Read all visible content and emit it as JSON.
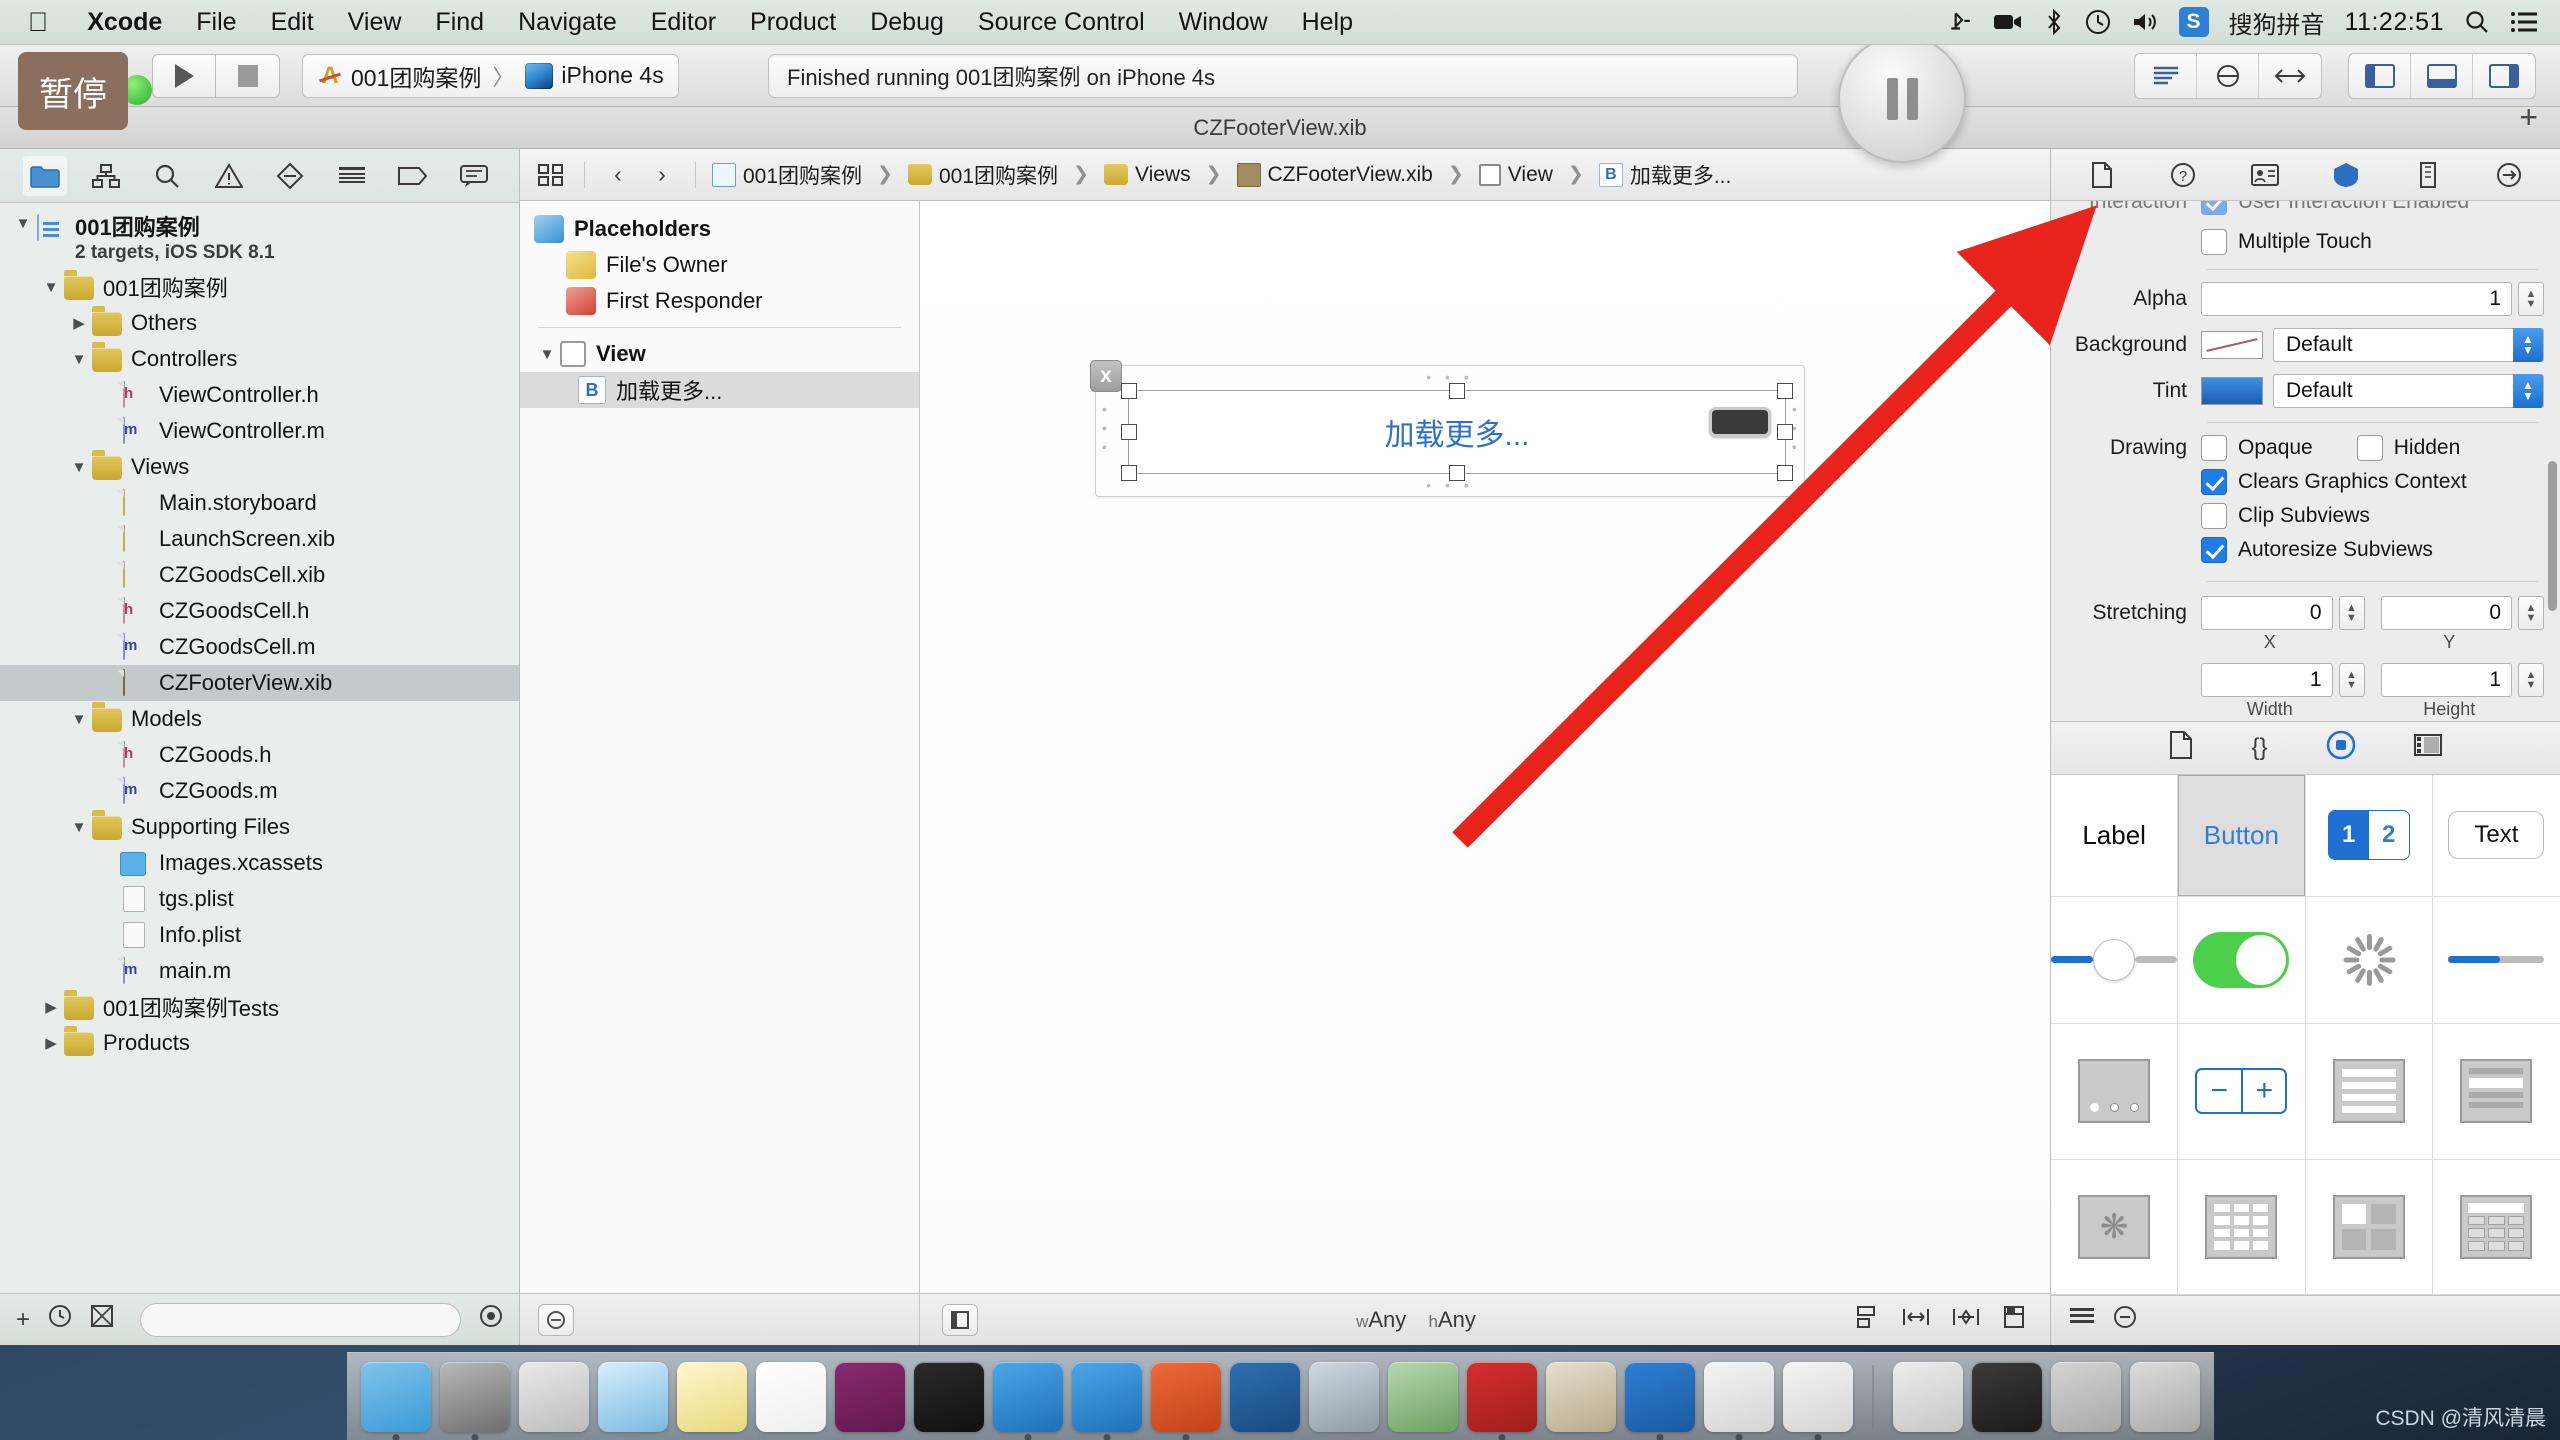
{
  "menubar": {
    "apple": "apple-logo",
    "items": [
      {
        "label": "Xcode",
        "bold": true
      },
      {
        "label": "File",
        "bold": false
      },
      {
        "label": "Edit",
        "bold": false
      },
      {
        "label": "View",
        "bold": false
      },
      {
        "label": "Find",
        "bold": false
      },
      {
        "label": "Navigate",
        "bold": false
      },
      {
        "label": "Editor",
        "bold": false
      },
      {
        "label": "Product",
        "bold": false
      },
      {
        "label": "Debug",
        "bold": false
      },
      {
        "label": "Source Control",
        "bold": false
      },
      {
        "label": "Window",
        "bold": false
      },
      {
        "label": "Help",
        "bold": false
      }
    ],
    "status": {
      "airplay": "⇥",
      "screen_record": "screen-record-icon",
      "bluetooth": "bluetooth-icon",
      "time_machine": "time-machine-icon",
      "volume": "volume-icon",
      "sogou_badge": "S",
      "input_method": "搜狗拼音",
      "clock": "11:22:51",
      "spotlight": "search-icon",
      "notification": "notification-center-icon"
    }
  },
  "toolbar": {
    "tooltip_pause": "暂停",
    "run_label": "run-button",
    "stop_label": "stop-button",
    "scheme_project": "001团购案例",
    "scheme_sep": "〉",
    "scheme_device": "iPhone 4s",
    "status_text": "Finished running 001团购案例 on iPhone 4s",
    "pause_button": "pause-button",
    "editor_modes": [
      "standard-editor",
      "assistant-editor",
      "version-editor"
    ],
    "view_toggles": [
      "navigator-toggle",
      "debug-area-toggle",
      "utilities-toggle"
    ],
    "add_tab": "+"
  },
  "window": {
    "title": "CZFooterView.xib"
  },
  "navigator": {
    "tabs": [
      {
        "name": "project-navigator",
        "glyph": "folder",
        "active": true
      },
      {
        "name": "symbol-navigator",
        "glyph": "hierarchy",
        "active": false
      },
      {
        "name": "find-navigator",
        "glyph": "search",
        "active": false
      },
      {
        "name": "issue-navigator",
        "glyph": "warning",
        "active": false
      },
      {
        "name": "test-navigator",
        "glyph": "diamond",
        "active": false
      },
      {
        "name": "debug-navigator",
        "glyph": "list",
        "active": false
      },
      {
        "name": "breakpoint-navigator",
        "glyph": "tag",
        "active": false
      },
      {
        "name": "log-navigator",
        "glyph": "speech",
        "active": false
      }
    ],
    "tree": [
      {
        "label": "001团购案例",
        "sub": "2 targets, iOS SDK 8.1",
        "indent": 0,
        "twist": "open",
        "icon": "project",
        "bold": true,
        "selected": false
      },
      {
        "label": "001团购案例",
        "indent": 1,
        "twist": "open",
        "icon": "folder",
        "selected": false
      },
      {
        "label": "Others",
        "indent": 2,
        "twist": "closed",
        "icon": "folder",
        "selected": false
      },
      {
        "label": "Controllers",
        "indent": 2,
        "twist": "open",
        "icon": "folder",
        "selected": false
      },
      {
        "label": "ViewController.h",
        "indent": 3,
        "twist": "none",
        "icon": "h",
        "selected": false
      },
      {
        "label": "ViewController.m",
        "indent": 3,
        "twist": "none",
        "icon": "m",
        "selected": false
      },
      {
        "label": "Views",
        "indent": 2,
        "twist": "open",
        "icon": "folder",
        "selected": false
      },
      {
        "label": "Main.storyboard",
        "indent": 3,
        "twist": "none",
        "icon": "xib",
        "selected": false
      },
      {
        "label": "LaunchScreen.xib",
        "indent": 3,
        "twist": "none",
        "icon": "xib",
        "selected": false
      },
      {
        "label": "CZGoodsCell.xib",
        "indent": 3,
        "twist": "none",
        "icon": "xib",
        "selected": false
      },
      {
        "label": "CZGoodsCell.h",
        "indent": 3,
        "twist": "none",
        "icon": "h",
        "selected": false
      },
      {
        "label": "CZGoodsCell.m",
        "indent": 3,
        "twist": "none",
        "icon": "m",
        "selected": false
      },
      {
        "label": "CZFooterView.xib",
        "indent": 3,
        "twist": "none",
        "icon": "dark",
        "selected": true
      },
      {
        "label": "Models",
        "indent": 2,
        "twist": "open",
        "icon": "folder",
        "selected": false
      },
      {
        "label": "CZGoods.h",
        "indent": 3,
        "twist": "none",
        "icon": "h",
        "selected": false
      },
      {
        "label": "CZGoods.m",
        "indent": 3,
        "twist": "none",
        "icon": "m",
        "selected": false
      },
      {
        "label": "Supporting Files",
        "indent": 2,
        "twist": "open",
        "icon": "folder",
        "selected": false
      },
      {
        "label": "Images.xcassets",
        "indent": 3,
        "twist": "none",
        "icon": "asset",
        "selected": false
      },
      {
        "label": "tgs.plist",
        "indent": 3,
        "twist": "none",
        "icon": "plist",
        "selected": false
      },
      {
        "label": "Info.plist",
        "indent": 3,
        "twist": "none",
        "icon": "plist",
        "selected": false
      },
      {
        "label": "main.m",
        "indent": 3,
        "twist": "none",
        "icon": "m",
        "selected": false
      },
      {
        "label": "001团购案例Tests",
        "indent": 1,
        "twist": "closed",
        "icon": "folder",
        "selected": false
      },
      {
        "label": "Products",
        "indent": 1,
        "twist": "closed",
        "icon": "folder",
        "selected": false
      }
    ],
    "bottom": {
      "add": "+",
      "recent": "clock-icon",
      "source_control": "source-control-icon",
      "filter_placeholder": ""
    }
  },
  "jumpbar": {
    "related_items": "related-items-icon",
    "back": "‹",
    "forward": "›",
    "crumbs": [
      {
        "label": "001团购案例",
        "icon": "project"
      },
      {
        "label": "001团购案例",
        "icon": "folder"
      },
      {
        "label": "Views",
        "icon": "folder"
      },
      {
        "label": "CZFooterView.xib",
        "icon": "xib-dark"
      },
      {
        "label": "View",
        "icon": "view-square"
      },
      {
        "label": "加载更多...",
        "icon": "button-b"
      }
    ]
  },
  "outline": {
    "rows": [
      {
        "label": "Placeholders",
        "icon": "cube-blue",
        "bold": true,
        "indent": 0,
        "selected": false,
        "twist": "none"
      },
      {
        "label": "File's Owner",
        "icon": "cube-yellow",
        "bold": false,
        "indent": 1,
        "selected": false,
        "twist": "none"
      },
      {
        "label": "First Responder",
        "icon": "cube-red",
        "bold": false,
        "indent": 1,
        "selected": false,
        "twist": "none"
      }
    ],
    "view_row": {
      "label": "View",
      "bold": true,
      "twist": "open"
    },
    "button_row": {
      "label": "加载更多...",
      "badge": "B",
      "selected": true
    },
    "bottom_button": "filter-button"
  },
  "canvas": {
    "button_title": "加载更多...",
    "close_badge": "x",
    "size_class": "wAny hAny",
    "size_class_w": "w",
    "size_class_h": "h",
    "left_toggle": "document-outline-toggle",
    "right_icons": [
      "align-icon",
      "pin-icon",
      "resolve-issues-icon",
      "resizing-icon"
    ]
  },
  "inspector": {
    "tabs": [
      {
        "name": "file-inspector",
        "glyph": "file",
        "active": false
      },
      {
        "name": "quick-help-inspector",
        "glyph": "?",
        "active": false
      },
      {
        "name": "identity-inspector",
        "glyph": "id",
        "active": false
      },
      {
        "name": "attributes-inspector",
        "glyph": "attr",
        "active": true
      },
      {
        "name": "size-inspector",
        "glyph": "size",
        "active": false
      },
      {
        "name": "connections-inspector",
        "glyph": "conn",
        "active": false
      }
    ],
    "clipped_row": {
      "label": "Interaction",
      "checkbox": "User Interaction Enabled",
      "checked": true
    },
    "multiple_touch": {
      "label": "Multiple Touch",
      "checked": false
    },
    "alpha": {
      "label": "Alpha",
      "value": "1"
    },
    "background": {
      "label": "Background",
      "value": "Default"
    },
    "tint": {
      "label": "Tint",
      "value": "Default"
    },
    "drawing": {
      "label": "Drawing",
      "opaque": {
        "label": "Opaque",
        "checked": false
      },
      "hidden": {
        "label": "Hidden",
        "checked": false
      },
      "clears_graphics_context": {
        "label": "Clears Graphics Context",
        "checked": true
      },
      "clip_subviews": {
        "label": "Clip Subviews",
        "checked": false
      },
      "autoresize_subviews": {
        "label": "Autoresize Subviews",
        "checked": true
      }
    },
    "stretching": {
      "label": "Stretching",
      "x": {
        "value": "0",
        "caption": "X"
      },
      "y": {
        "value": "0",
        "caption": "Y"
      },
      "width": {
        "value": "1",
        "caption": "Width"
      },
      "height": {
        "value": "1",
        "caption": "Height"
      }
    }
  },
  "library": {
    "tabs": [
      {
        "name": "file-template-library",
        "glyph": "📄",
        "active": false
      },
      {
        "name": "code-snippet-library",
        "glyph": "{}",
        "active": false
      },
      {
        "name": "object-library",
        "glyph": "◎",
        "active": true
      },
      {
        "name": "media-library",
        "glyph": "▤",
        "active": false
      }
    ],
    "objects": [
      {
        "name": "label",
        "caption": "Label"
      },
      {
        "name": "button",
        "caption": "Button"
      },
      {
        "name": "segmented-control",
        "caption": "1 2"
      },
      {
        "name": "text-field",
        "caption": "Text"
      },
      {
        "name": "slider",
        "caption": ""
      },
      {
        "name": "switch",
        "caption": ""
      },
      {
        "name": "activity-indicator",
        "caption": ""
      },
      {
        "name": "progress-view",
        "caption": ""
      },
      {
        "name": "page-control",
        "caption": ""
      },
      {
        "name": "stepper",
        "caption": ""
      },
      {
        "name": "table-view",
        "caption": ""
      },
      {
        "name": "table-view-cell",
        "caption": ""
      },
      {
        "name": "image-view",
        "caption": ""
      },
      {
        "name": "collection-view",
        "caption": ""
      },
      {
        "name": "collection-view-cell",
        "caption": ""
      },
      {
        "name": "collection-reusable-view",
        "caption": ""
      }
    ],
    "segment_left": "1",
    "segment_right": "2",
    "bottom": {
      "list_toggle": "list-view-icon",
      "filter": "filter-icon"
    }
  },
  "dock": {
    "items": [
      {
        "name": "finder",
        "color1": "#7fc4ec",
        "color2": "#3c9ad6"
      },
      {
        "name": "system-preferences",
        "color1": "#b9b9b9",
        "color2": "#6d6d6d"
      },
      {
        "name": "launchpad",
        "color1": "#e9e9e9",
        "color2": "#bcbcbc"
      },
      {
        "name": "safari",
        "color1": "#d7eefc",
        "color2": "#7ab9e0"
      },
      {
        "name": "notes",
        "color1": "#fff7cf",
        "color2": "#e8d87d"
      },
      {
        "name": "microsoft-excel",
        "color1": "#ffffff",
        "color2": "#eeeeee"
      },
      {
        "name": "microsoft-onenote",
        "color1": "#8a2a6e",
        "color2": "#62184d"
      },
      {
        "name": "terminal",
        "color1": "#2b2b2b",
        "color2": "#101010"
      },
      {
        "name": "xcode-hammer",
        "color1": "#4aa8e8",
        "color2": "#1e6fb8"
      },
      {
        "name": "simulator",
        "color1": "#4aa8e8",
        "color2": "#1e6fb8"
      },
      {
        "name": "pycharm",
        "color1": "#ee6a3a",
        "color2": "#c3401a"
      },
      {
        "name": "snipaste",
        "color1": "#2e6fb0",
        "color2": "#174a80"
      },
      {
        "name": "quicktime",
        "color1": "#cfd8df",
        "color2": "#8e9aa4"
      },
      {
        "name": "parallels",
        "color1": "#b8d7b0",
        "color2": "#6ba05e"
      },
      {
        "name": "filezilla",
        "color1": "#d62f2f",
        "color2": "#a01d1d"
      },
      {
        "name": "gimp",
        "color1": "#e6dfcc",
        "color2": "#b7a98c"
      },
      {
        "name": "microsoft-word",
        "color1": "#2f7fd4",
        "color2": "#1a59a0"
      },
      {
        "name": "app-store-a",
        "color1": "#f4f4f4",
        "color2": "#d4d4d4"
      },
      {
        "name": "app-store-b",
        "color1": "#f4f4f4",
        "color2": "#d4d4d4"
      },
      {
        "name": "separator",
        "color1": "",
        "color2": ""
      },
      {
        "name": "document-stack",
        "color1": "#ececec",
        "color2": "#c6c6c6"
      },
      {
        "name": "screens-a",
        "color1": "#3b3b3b",
        "color2": "#1a1a1a"
      },
      {
        "name": "screens-b",
        "color1": "#d4d4d4",
        "color2": "#a8a8a8"
      },
      {
        "name": "trash",
        "color1": "#dcdcdc",
        "color2": "#a9a9a9"
      }
    ]
  },
  "watermark": "CSDN @清风清晨",
  "colors": {
    "accent_blue": "#1f6fd0",
    "button_title_blue": "#2b6fd4",
    "selection_gray": "#c4c9cc",
    "menubar_bg": "#dfe9e4",
    "arrow_red": "#e8241c"
  }
}
